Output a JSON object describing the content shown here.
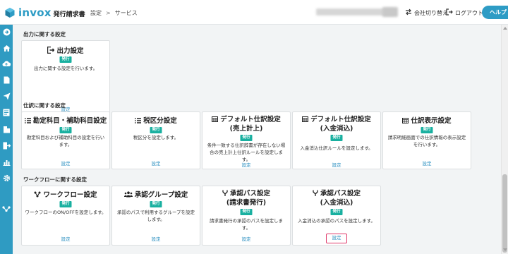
{
  "header": {
    "logo_text": "invox",
    "logo_sub": "発行請求書",
    "breadcrumb": [
      "設定",
      "サービス"
    ],
    "switch_company": "会社切り替え",
    "logout": "ログアウト",
    "help": "ヘルプ"
  },
  "sidebar": {
    "icons": [
      "arrow-right-circle-icon",
      "home-icon",
      "cloud-upload-icon",
      "document-icon",
      "send-icon",
      "document-list-icon",
      "building-icon",
      "export-icon",
      "chart-icon",
      "gear-icon",
      "workflow-icon"
    ]
  },
  "colors": {
    "accent": "#2f9bc2",
    "badge": "#19b0a0",
    "link": "#2a8fc0",
    "highlight": "#e0396b"
  },
  "sections": [
    {
      "title": "出力に関する設定",
      "cards": [
        {
          "title": "出力設定",
          "icon": "export-icon",
          "badge": "発行",
          "desc": "出力に関する設定を行います。",
          "link": "設定"
        }
      ]
    },
    {
      "title": "仕訳に関する設定",
      "cards": [
        {
          "title": "勘定科目・補助科目設定",
          "icon": "list-icon",
          "badge": "発行",
          "desc": "勘定科目および補助科目の設定を行います。",
          "link": "設定"
        },
        {
          "title": "税区分設定",
          "icon": "list-icon",
          "badge": "発行",
          "desc": "税区分を設定します。",
          "link": "設定"
        },
        {
          "title": "デフォルト仕訳設定",
          "title2": "(売上計上)",
          "icon": "table-icon",
          "badge": "発行",
          "desc": "条件一致する仕訳辞書が存在しない場合の売上計上仕訳ルールを設定します。",
          "link": "設定"
        },
        {
          "title": "デフォルト仕訳設定",
          "title2": "(入金消込)",
          "icon": "table-icon",
          "badge": "発行",
          "desc": "入金消込仕訳ルールを設定します。",
          "link": "設定"
        },
        {
          "title": "仕訳表示設定",
          "icon": "table-icon",
          "badge": "発行",
          "desc": "請求明細画面での仕訳情報の表示設定を行います。",
          "link": "設定"
        }
      ]
    },
    {
      "title": "ワークフローに関する設定",
      "cards": [
        {
          "title": "ワークフロー設定",
          "icon": "workflow-icon",
          "badge": "発行",
          "desc": "ワークフローのON/OFFを設定します。",
          "link": "設定"
        },
        {
          "title": "承認グループ設定",
          "icon": "users-icon",
          "badge": "発行",
          "desc": "承認のパスで利用するグループを設定します。",
          "link": "設定"
        },
        {
          "title": "承認パス設定",
          "title2": "(請求書発行)",
          "icon": "branch-icon",
          "badge": "発行",
          "desc": "請求書発行の承認のパスを設定します。",
          "link": "設定"
        },
        {
          "title": "承認パス設定",
          "title2": "(入金消込)",
          "icon": "branch-icon",
          "badge": "発行",
          "desc": "入金消込の承認のパスを設定します。",
          "link": "設定"
        }
      ]
    }
  ]
}
